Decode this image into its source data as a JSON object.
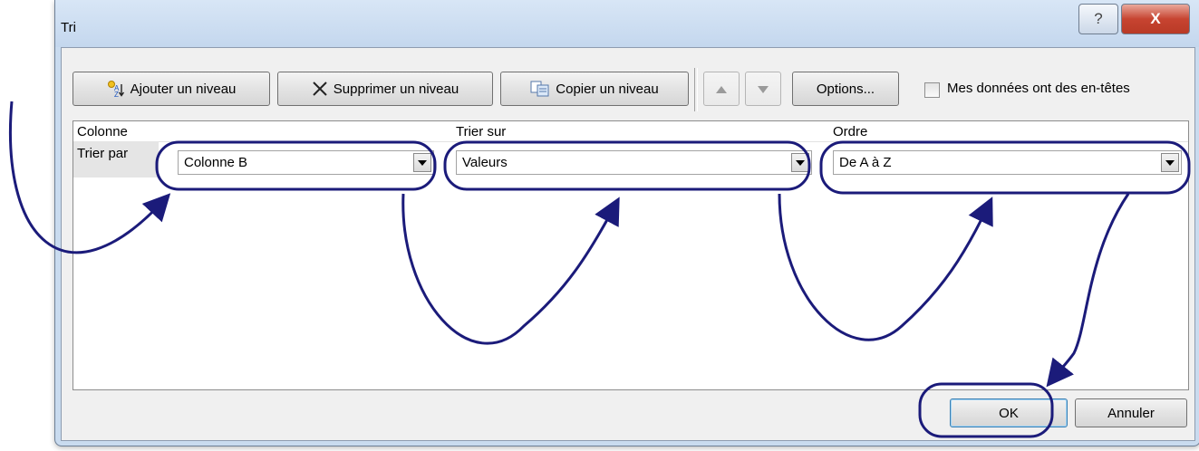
{
  "window": {
    "title": "Tri",
    "help_label": "?",
    "close_label": "X"
  },
  "toolbar": {
    "add_level_label": "Ajouter un niveau",
    "delete_level_label": "Supprimer un niveau",
    "copy_level_label": "Copier un niveau",
    "options_label": "Options...",
    "headers_checkbox_label": "Mes données ont des en-têtes",
    "headers_checked": false
  },
  "grid": {
    "columns": [
      "Colonne",
      "Trier sur",
      "Ordre"
    ],
    "row": {
      "label": "Trier par",
      "column_value": "Colonne B",
      "sort_on_value": "Valeurs",
      "order_value": "De A à Z"
    }
  },
  "footer": {
    "ok_label": "OK",
    "cancel_label": "Annuler"
  },
  "colors": {
    "annotation": "#1b1b7a",
    "titlebar": "#c9dbef",
    "close_button": "#c74431"
  },
  "icons": [
    "add-level-icon",
    "delete-icon",
    "copy-icon",
    "arrow-up-icon",
    "arrow-down-icon",
    "dropdown-arrow-icon",
    "help-icon",
    "close-icon"
  ]
}
